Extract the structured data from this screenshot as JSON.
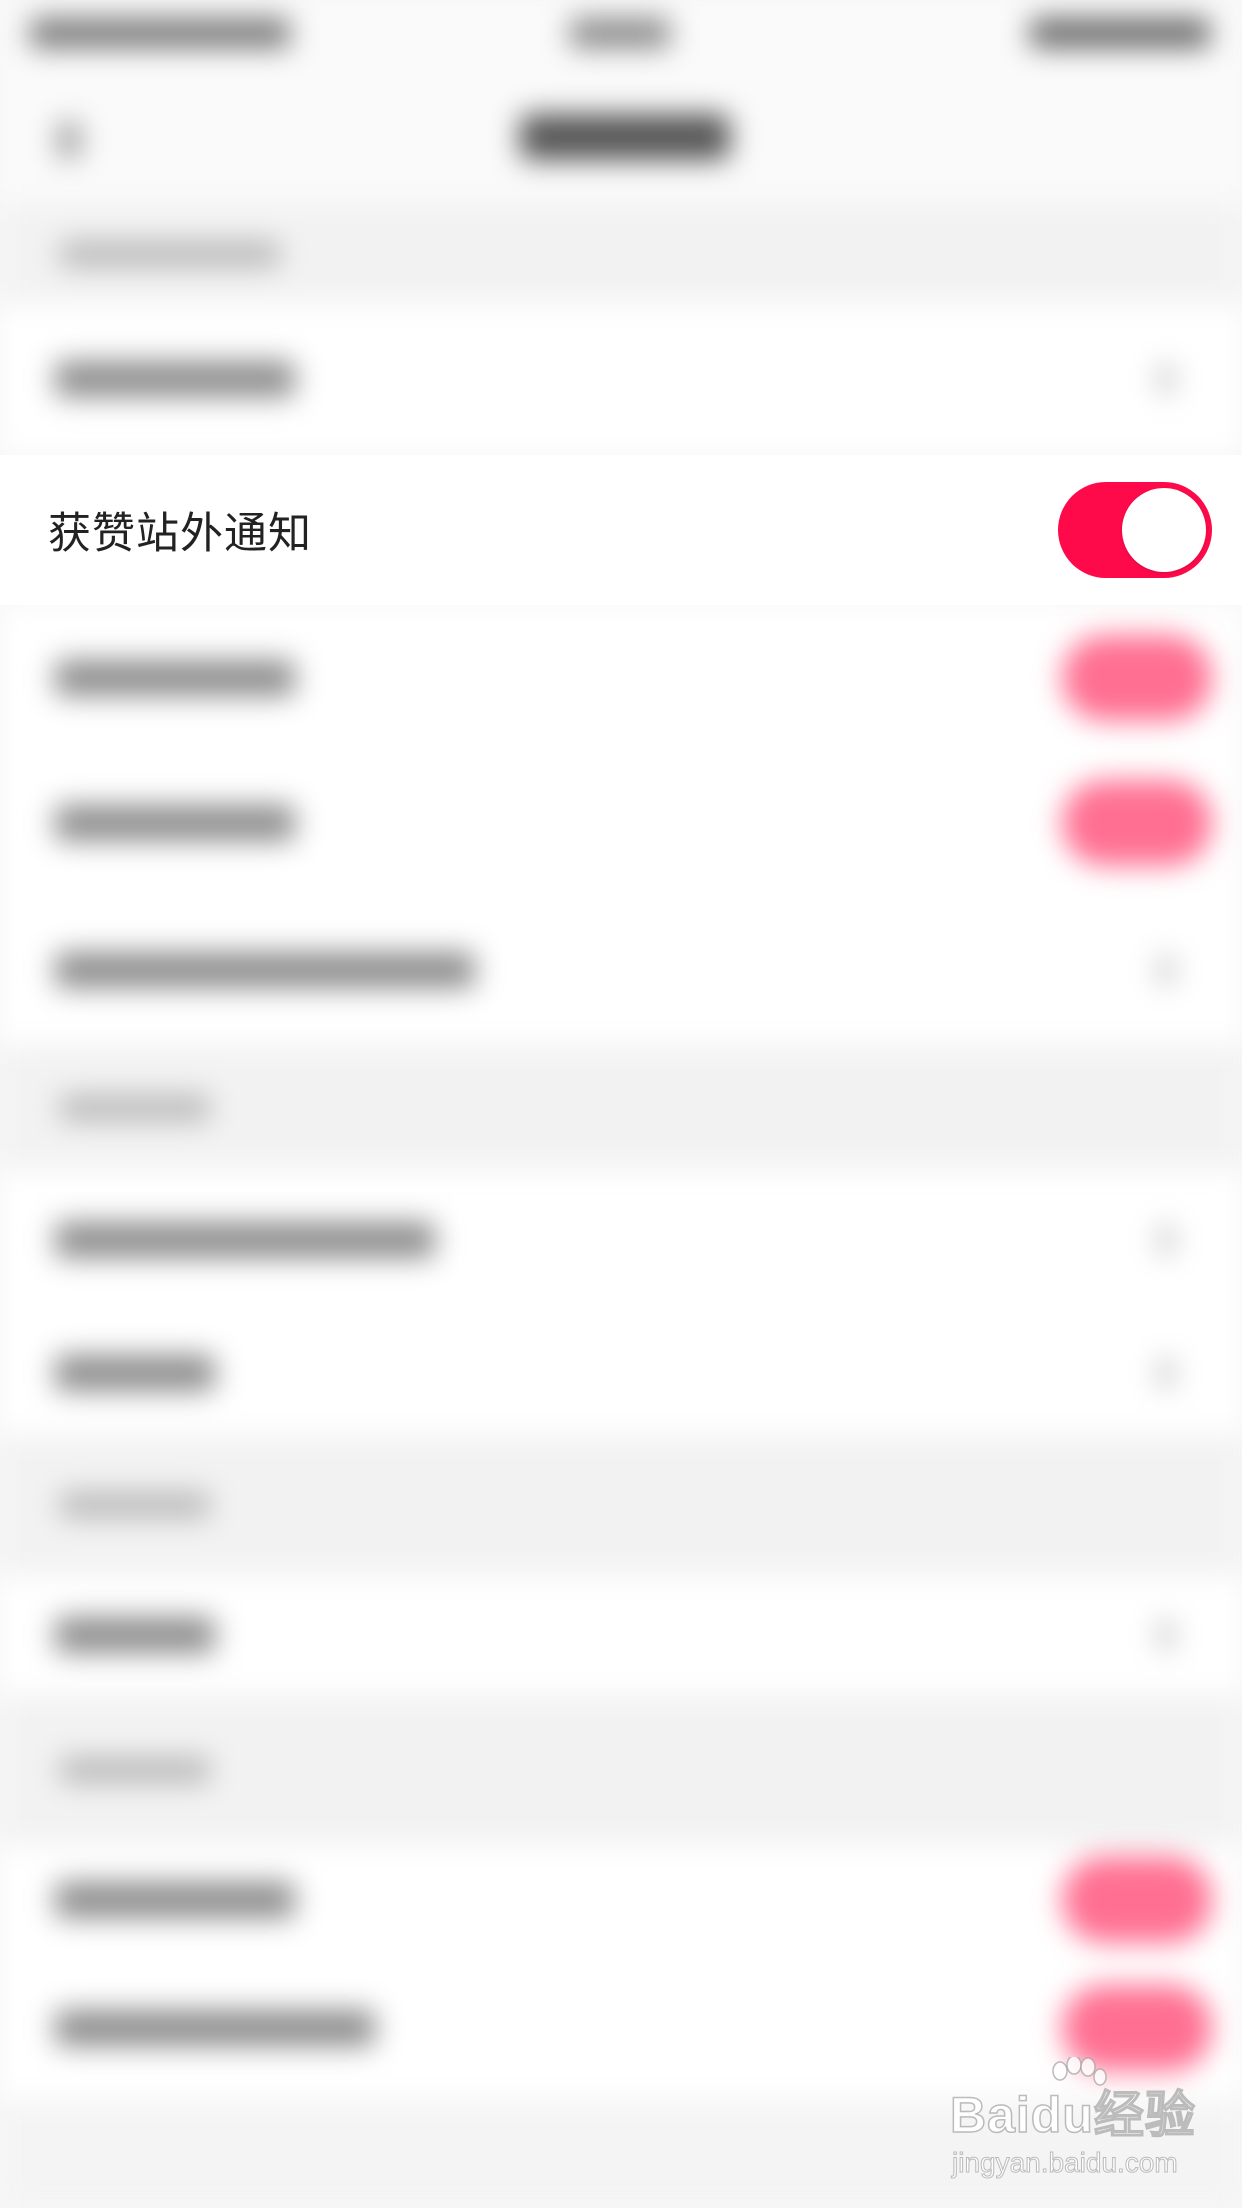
{
  "focused_setting": {
    "label": "获赞站外通知",
    "toggle_on": true,
    "toggle_color": "#fe0a4a"
  },
  "watermark": {
    "text": "Baidu经验",
    "url_text": "jingyan.baidu.com"
  }
}
